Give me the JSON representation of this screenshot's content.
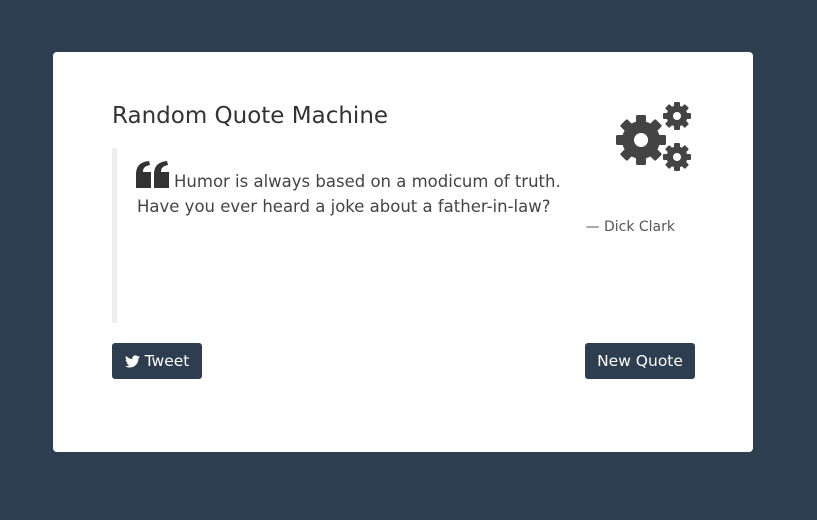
{
  "app": {
    "title": "Random Quote Machine"
  },
  "quote": {
    "text": "Humor is always based on a modicum of truth. Have you ever heard a joke about a father-in-law?",
    "author": "— Dick Clark"
  },
  "buttons": {
    "tweet_label": "Tweet",
    "new_quote_label": "New Quote"
  },
  "icons": {
    "gears": "gears-icon",
    "quote": "quote-left-icon",
    "twitter": "twitter-icon"
  },
  "colors": {
    "background": "#2c3e50",
    "card": "#ffffff",
    "accent": "#2c3e50",
    "icon": "#444444"
  }
}
